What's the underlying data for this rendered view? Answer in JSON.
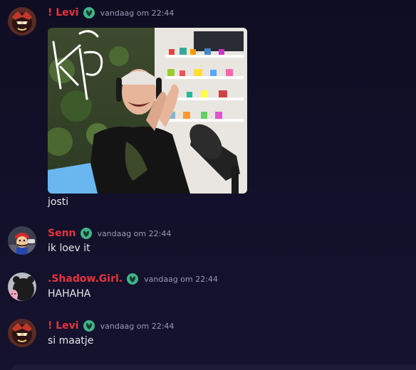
{
  "messages": [
    {
      "username": "! Levi",
      "timestamp": "vandaag om 22:44",
      "text": "josti",
      "avatar_icon": "levi-avatar-icon",
      "role_icon": "leaf-role-icon",
      "attachment": "image-attachment"
    },
    {
      "username": "Senn",
      "timestamp": "vandaag om 22:44",
      "text": "ik loev it",
      "avatar_icon": "mario-avatar-icon",
      "role_icon": "leaf-role-icon"
    },
    {
      "username": ".Shadow.Girl.",
      "timestamp": "vandaag om 22:44",
      "text": "HAHAHA",
      "avatar_icon": "shadow-avatar-icon",
      "role_icon": "leaf-role-icon"
    },
    {
      "username": "! Levi",
      "timestamp": "vandaag om 22:44",
      "text": "si maatje",
      "avatar_icon": "levi-avatar-icon",
      "role_icon": "leaf-role-icon"
    }
  ],
  "colors": {
    "username": "#e8323f",
    "role_icon": "#3fb58a",
    "timestamp": "#9a98b2",
    "background": "#121029"
  }
}
